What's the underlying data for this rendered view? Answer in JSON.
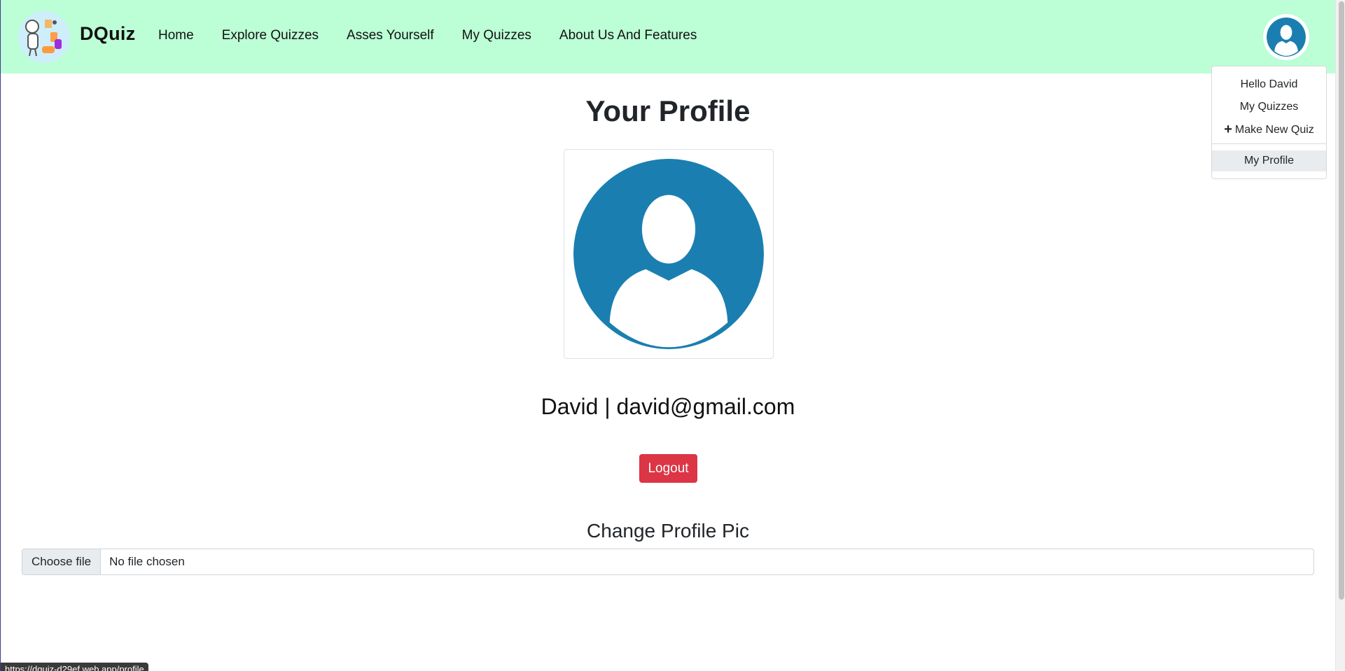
{
  "brand": {
    "name": "DQuiz"
  },
  "nav": {
    "links": [
      "Home",
      "Explore Quizzes",
      "Asses Yourself",
      "My Quizzes",
      "About Us And Features"
    ]
  },
  "dropdown": {
    "greeting": "Hello David",
    "my_quizzes": "My Quizzes",
    "make_new_quiz": "Make New Quiz",
    "my_profile": "My Profile"
  },
  "profile": {
    "title": "Your Profile",
    "user_line": "David | david@gmail.com",
    "logout_label": "Logout",
    "change_pic_title": "Change Profile Pic",
    "file_button": "Choose file",
    "file_status": "No file chosen"
  },
  "status_bar": {
    "url": "https://dquiz-d29ef.web.app/profile"
  },
  "colors": {
    "navbar_bg": "#bcfed6",
    "avatar_blue": "#1a7fb0",
    "logout_red": "#dc3545"
  }
}
